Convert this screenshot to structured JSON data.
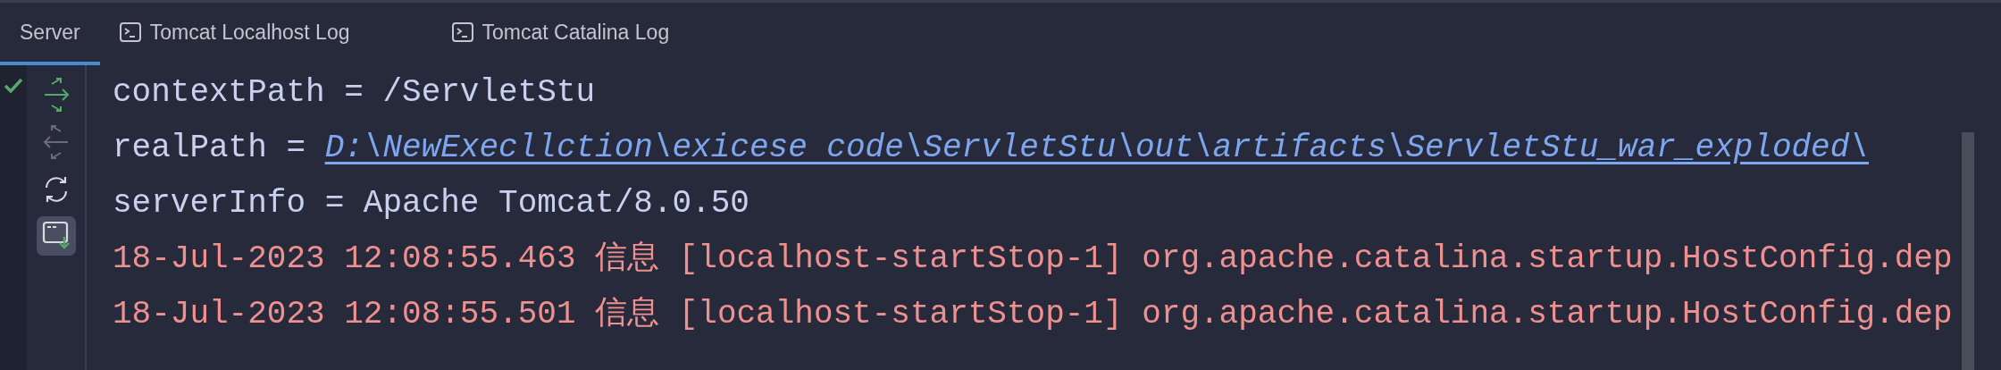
{
  "tabs": [
    {
      "label": "Server",
      "selected": true,
      "kind": "plain"
    },
    {
      "label": "Tomcat Localhost Log",
      "selected": false,
      "kind": "console"
    },
    {
      "label": "Tomcat Catalina Log",
      "selected": false,
      "kind": "console"
    }
  ],
  "status": {
    "ok": true
  },
  "toolbar": [
    {
      "kind": "deploy",
      "disabled": false,
      "selected": false
    },
    {
      "kind": "undeploy",
      "disabled": true,
      "selected": false
    },
    {
      "kind": "refresh",
      "disabled": false,
      "selected": false
    },
    {
      "kind": "output",
      "disabled": false,
      "selected": true
    }
  ],
  "lines": [
    {
      "parts": [
        {
          "kind": "plain",
          "text": "contextPath = /ServletStu"
        }
      ]
    },
    {
      "parts": [
        {
          "kind": "plain",
          "text": "realPath = "
        },
        {
          "kind": "link",
          "text": "D:\\NewExecllction\\exicese code\\ServletStu\\out\\artifacts\\ServletStu_war_exploded\\"
        }
      ]
    },
    {
      "parts": [
        {
          "kind": "plain",
          "text": "serverInfo = Apache Tomcat/8.0.50"
        }
      ]
    },
    {
      "parts": [
        {
          "kind": "log",
          "text": "18-Jul-2023 12:08:55.463 信息 [localhost-startStop-1] org.apache.catalina.startup.HostConfig.dep"
        }
      ]
    },
    {
      "parts": [
        {
          "kind": "log",
          "text": "18-Jul-2023 12:08:55.501 信息 [localhost-startStop-1] org.apache.catalina.startup.HostConfig.dep"
        }
      ]
    }
  ]
}
